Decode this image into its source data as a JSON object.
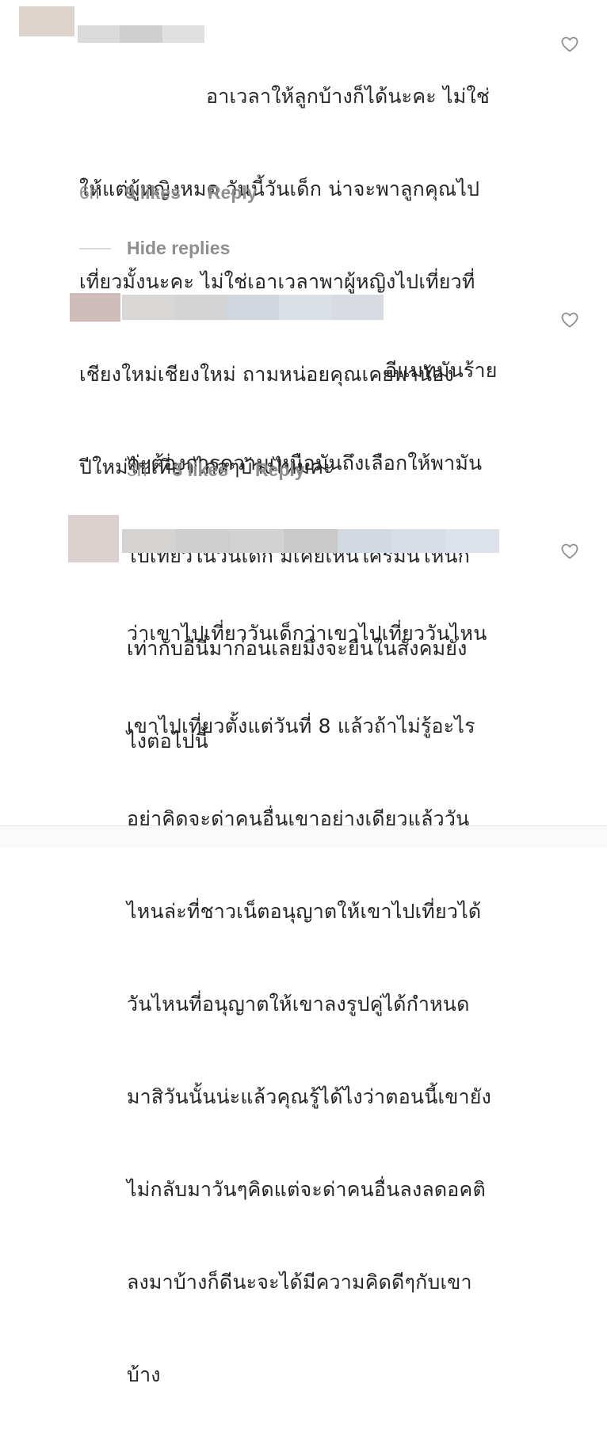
{
  "colors": {
    "text": "#262626",
    "meta": "#8e8e8e",
    "divider": "#dbdbdb",
    "avatar": "#dcd3cc"
  },
  "comments": [
    {
      "text_lines": [
        "อาเวลาให้ลูกบ้างก็ได้นะคะ ไม่ใช่",
        "ให้แต่ผู้หญิงหมด วันนี้วันเด็ก น่าจะพาลูกคุณไป",
        "เที่ยวมั้งนะคะ ไม่ใช่เอาเวลาพาผู้หญิงไปเที่ยวที่",
        "เชียงใหม่เชียงใหม่ ถามหน่อยคุณเคยพาน้อง",
        "ปีใหม่ไปเที่ยวไกลๆบ้างไหมคะ"
      ],
      "time": "6h",
      "likes": "9 likes",
      "reply": "Reply",
      "like_icon": "heart-outline-icon"
    },
    {
      "text_lines": [
        "อีแมทมันร้าย",
        "ค่ะต้องการความเหนือมันถึงเลือกให้พามัน",
        "ไปเที่ยวในวันเด็ก ม่เคยเหนใครมั่นโหนก",
        "เท่ากับอีนี่มาก่อนเลยมึงจะยืนในสังคมยัง",
        "ไงต่อไปนี้"
      ],
      "time": "3h",
      "likes": "3 likes",
      "reply": "Reply",
      "like_icon": "heart-outline-icon"
    },
    {
      "text_lines": [
        "ว่าเขาไปเที่ยววันเด็กว่าเขาไปเที่ยววันไหน",
        "เขาไปเที่ยวตั้งแต่วันที่ 8 แล้วถ้าไม่รู้อะไร",
        "อย่าคิดจะด่าคนอื่นเขาอย่างเดียวแล้ววัน",
        "ไหนล่ะที่ชาวเน็ตอนุญาตให้เขาไปเที่ยวได้",
        "วันไหนที่อนุญาตให้เขาลงรูปคู่ได้กำหนด",
        "มาสิวันนั้นน่ะแล้วคุณรู้ได้ไงว่าตอนนี้เขายัง",
        "ไม่กลับมาวันๆคิดแต่จะด่าคนอื่นลงลดอคติ",
        "ลงมาบ้างก็ดีนะจะได้มีความคิดดีๆกับเขา",
        "บ้าง"
      ],
      "like_icon": "heart-outline-icon"
    }
  ],
  "hide_replies": "Hide replies"
}
